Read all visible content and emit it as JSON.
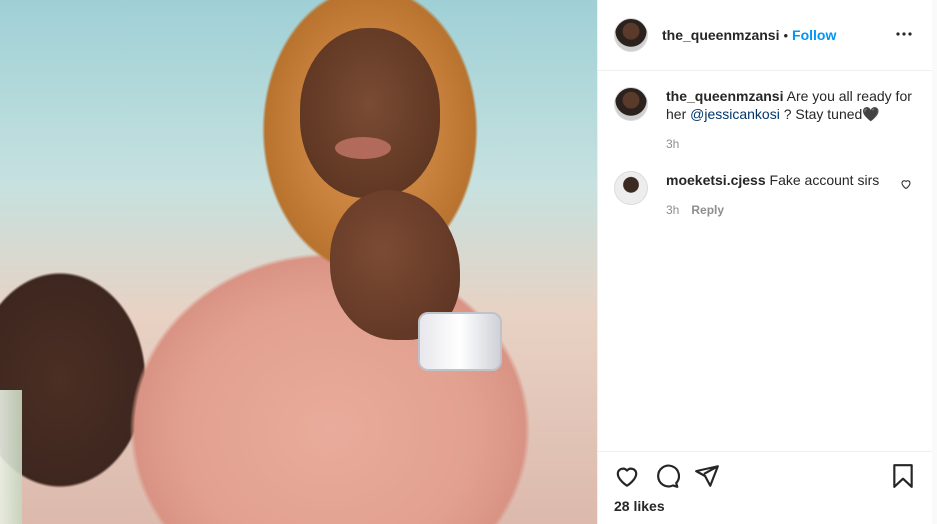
{
  "header": {
    "username": "the_queenmzansi",
    "separator": "•",
    "follow_label": "Follow",
    "more_label": "•••"
  },
  "comments": [
    {
      "username": "the_queenmzansi",
      "text_before": "Are you all ready for her",
      "mention": "@jessicankosi",
      "text_after": "? Stay tuned🖤",
      "time": "3h"
    },
    {
      "username": "moeketsi.cjess",
      "text": "Fake account sirs",
      "time": "3h",
      "reply_label": "Reply"
    }
  ],
  "actions": {
    "icons": [
      "heart-icon",
      "comment-icon",
      "share-icon",
      "bookmark-icon"
    ],
    "likes": "28 likes"
  },
  "colors": {
    "follow": "#0095f6",
    "mention": "#00376b",
    "muted": "#8e8e8e"
  }
}
